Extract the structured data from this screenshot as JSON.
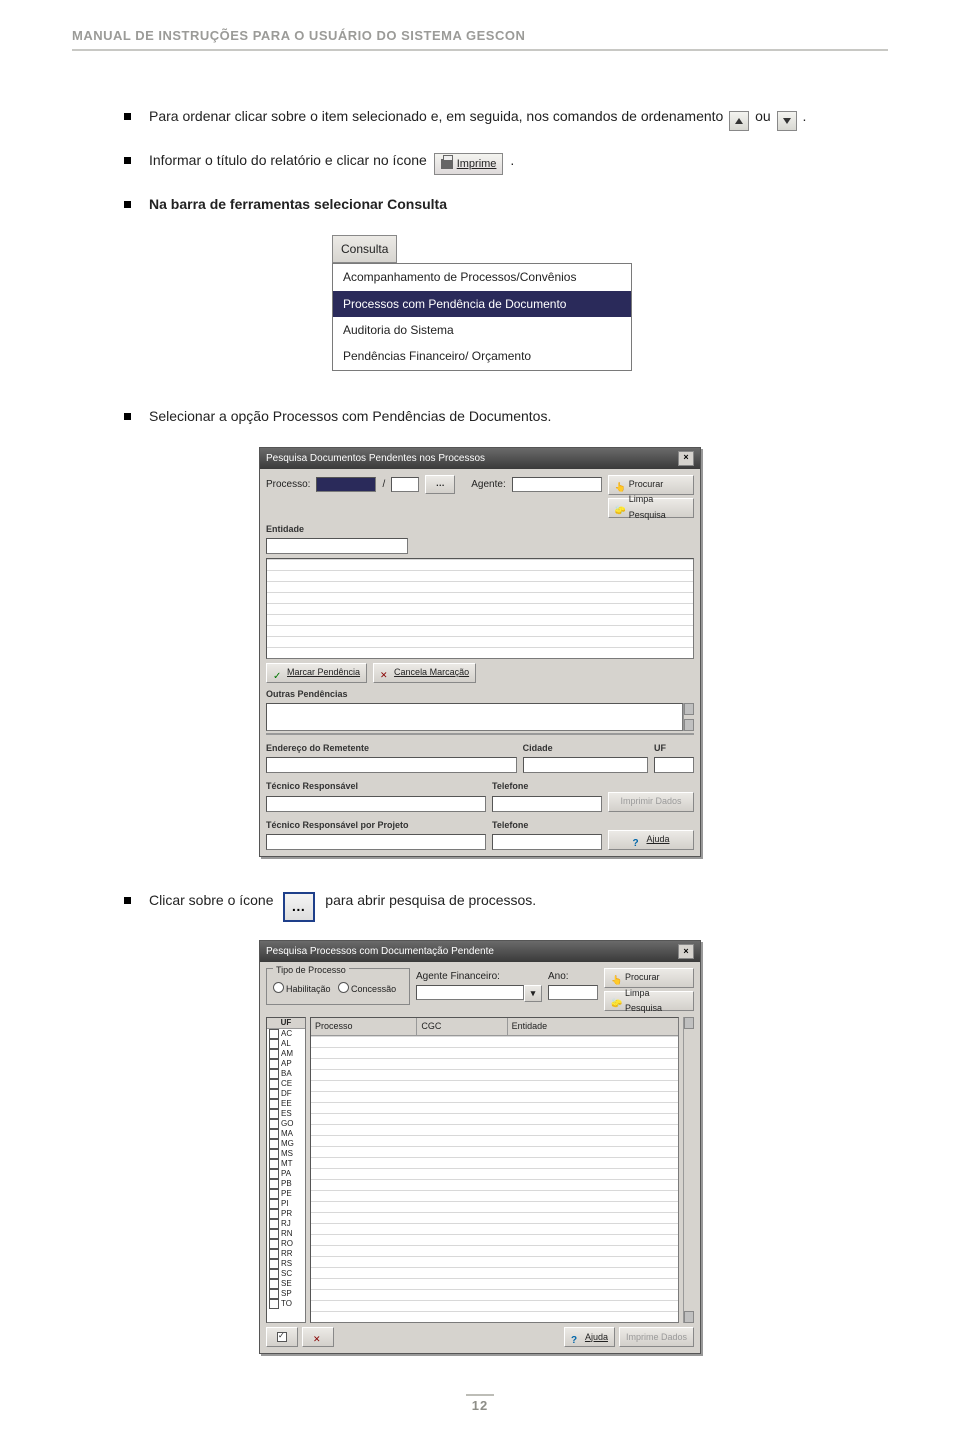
{
  "doc_header": "MANUAL DE INSTRUÇÕES PARA O USUÁRIO DO SISTEMA GESCON",
  "bullets": {
    "b1_pre": "Para ordenar clicar sobre o item selecionado e, em seguida, nos comandos de ordenamento ",
    "b1_mid": " ou ",
    "b1_end": ".",
    "b2_pre": "Informar o título do relatório e clicar no ícone ",
    "b2_end": ".",
    "imprime_label": "Imprime",
    "b3": "Na barra de ferramentas selecionar Consulta",
    "b4": "Selecionar a opção Processos com Pendências de Documentos.",
    "b5_pre": "Clicar sobre o ícone ",
    "b5_end": " para abrir pesquisa de processos."
  },
  "menu": {
    "title": "Consulta",
    "items": [
      "Acompanhamento de Processos/Convênios",
      "Processos com Pendência de Documento",
      "Auditoria do Sistema",
      "Pendências Financeiro/ Orçamento"
    ],
    "selected_index": 1
  },
  "dlg1": {
    "title": "Pesquisa Documentos Pendentes nos Processos",
    "processo_label": "Processo:",
    "agente_label": "Agente:",
    "procurar": "Procurar",
    "limpa": "Limpa Pesquisa",
    "entidade": "Entidade",
    "marcar": "Marcar Pendência",
    "cancela": "Cancela Marcação",
    "outras": "Outras Pendências",
    "endereco": "Endereço do Remetente",
    "cidade": "Cidade",
    "uf": "UF",
    "tec_resp": "Técnico Responsável",
    "telefone": "Telefone",
    "tec_proj": "Técnico Responsável por Projeto",
    "telefone2": "Telefone",
    "imprimir": "Imprimir Dados",
    "ajuda": "Ajuda"
  },
  "dlg2": {
    "title": "Pesquisa Processos com Documentação Pendente",
    "tipo_legend": "Tipo de Processo",
    "hab": "Habilitação",
    "conc": "Concessão",
    "agente": "Agente Financeiro:",
    "ano": "Ano:",
    "procurar": "Procurar",
    "limpa": "Limpa Pesquisa",
    "uf_header": "UF",
    "uf_list": [
      "AC",
      "AL",
      "AM",
      "AP",
      "BA",
      "CE",
      "DF",
      "EE",
      "ES",
      "GO",
      "MA",
      "MG",
      "MS",
      "MT",
      "PA",
      "PB",
      "PE",
      "PI",
      "PR",
      "RJ",
      "RN",
      "RO",
      "RR",
      "RS",
      "SC",
      "SE",
      "SP",
      "TO"
    ],
    "col_processo": "Processo",
    "col_cgc": "CGC",
    "col_entidade": "Entidade",
    "ajuda": "Ajuda",
    "imprimir": "Imprime Dados"
  },
  "page_number": "12"
}
